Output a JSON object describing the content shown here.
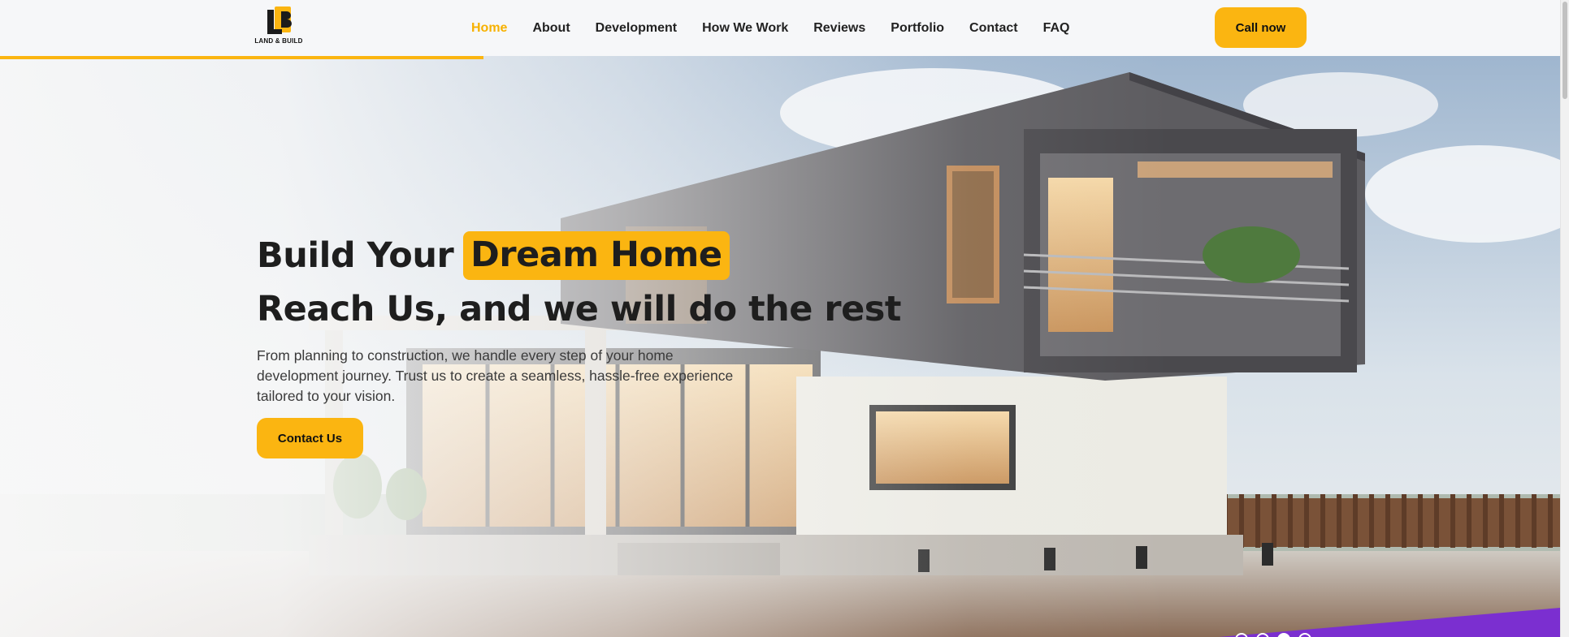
{
  "brand": {
    "logo_text": "LAND & BUILD",
    "accent": "#fbb511"
  },
  "nav": {
    "items": [
      {
        "label": "Home",
        "active": true
      },
      {
        "label": "About"
      },
      {
        "label": "Development"
      },
      {
        "label": "How We Work"
      },
      {
        "label": "Reviews"
      },
      {
        "label": "Portfolio"
      },
      {
        "label": "Contact"
      },
      {
        "label": "FAQ"
      }
    ],
    "cta_label": "Call now"
  },
  "scroll_progress": 0.31,
  "hero": {
    "headline_start": "Build Your",
    "headline_highlight": "Dream Home",
    "headline_line2": "Reach Us, and we will do the rest",
    "description": "From planning to construction, we handle every step of your home development journey. Trust us to create a seamless, hassle-free experience tailored to your vision.",
    "cta_label": "Contact Us",
    "slides": {
      "count": 4,
      "active_index": 2
    }
  }
}
